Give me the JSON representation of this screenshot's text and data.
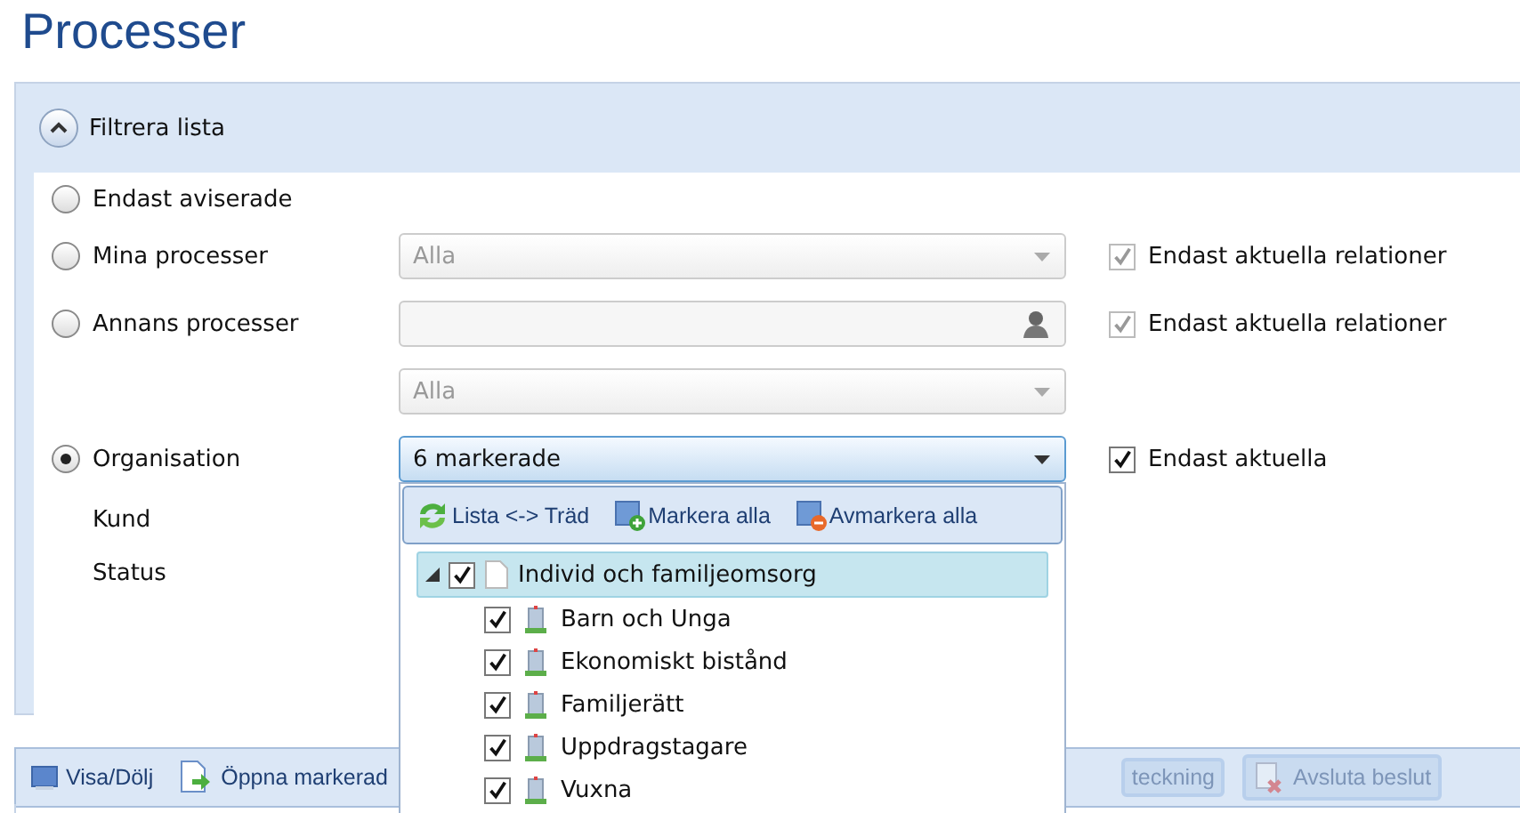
{
  "page_title": "Processer",
  "filter_panel": {
    "header": "Filtrera lista",
    "expanded": true,
    "rows": [
      {
        "kind": "radio",
        "label": "Endast aviserade",
        "selected": false
      },
      {
        "kind": "radio",
        "label": "Mina processer",
        "selected": false,
        "field": {
          "kind": "select",
          "value": "Alla",
          "focused": false,
          "disabled": true
        },
        "checkbox": {
          "label": "Endast aktuella relationer",
          "checked": true,
          "disabled": true
        }
      },
      {
        "kind": "radio",
        "label": "Annans processer",
        "selected": false,
        "field": {
          "kind": "person",
          "focused": false
        },
        "checkbox": {
          "label": "Endast aktuella relationer",
          "checked": true,
          "disabled": true
        }
      },
      {
        "kind": "blank",
        "field": {
          "kind": "select",
          "value": "Alla",
          "focused": false,
          "disabled": true
        }
      },
      {
        "kind": "radio",
        "label": "Organisation",
        "selected": true,
        "field": {
          "kind": "select",
          "value": "6 markerade",
          "focused": true,
          "disabled": false
        },
        "checkbox": {
          "label": "Endast aktuella",
          "checked": true,
          "disabled": false
        }
      },
      {
        "kind": "label",
        "label": "Kund"
      },
      {
        "kind": "label",
        "label": "Status"
      }
    ]
  },
  "dropdown": {
    "toolbar": [
      {
        "label": "Lista <-> Träd"
      },
      {
        "label": "Markera alla"
      },
      {
        "label": "Avmarkera alla"
      }
    ],
    "tree": [
      {
        "label": "Individ och familjeomsorg",
        "checked": true,
        "expanded": true,
        "selected": true,
        "children": [
          {
            "label": "Barn och Unga",
            "checked": true,
            "selected": false
          },
          {
            "label": "Ekonomiskt bistånd",
            "checked": true,
            "selected": false
          },
          {
            "label": "Familjerätt",
            "checked": true,
            "selected": false
          },
          {
            "label": "Uppdragstagare",
            "checked": true,
            "selected": false
          },
          {
            "label": "Vuxna",
            "checked": true,
            "selected": false
          }
        ]
      }
    ]
  },
  "toolbar": [
    {
      "label": "Visa/Dölj",
      "disabled": false
    },
    {
      "label": "Öppna markerad",
      "disabled": false
    },
    {
      "label": "teckning",
      "disabled": true
    },
    {
      "label": "Avsluta beslut",
      "disabled": true
    }
  ]
}
